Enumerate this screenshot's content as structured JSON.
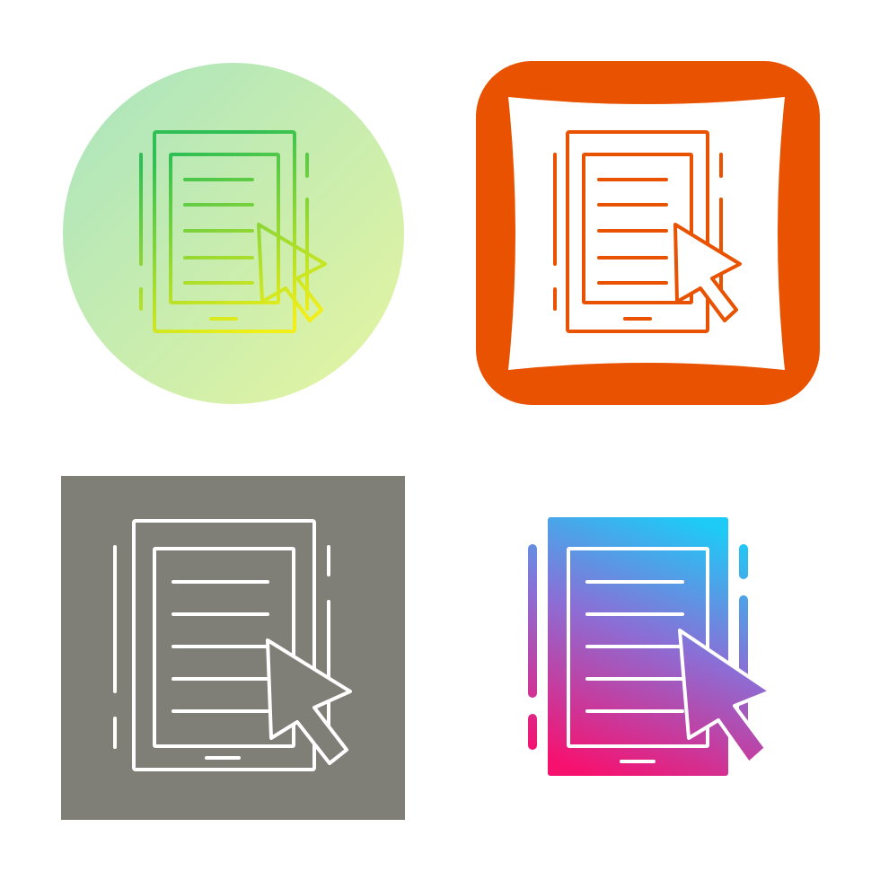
{
  "icon_set": {
    "subject": "tablet-document-cursor-icon",
    "variants": [
      {
        "style": "gradient-line-on-circle",
        "background_shape": "circle",
        "colors": {
          "background_from": "#a9e4bf",
          "background_to": "#e6f5a0",
          "stroke_from": "#2fbf54",
          "stroke_to": "#f1ef17"
        }
      },
      {
        "style": "line-on-cushion-square",
        "background_shape": "rounded-square",
        "colors": {
          "background": "#e85200",
          "cushion": "#ffffff",
          "stroke": "#e85200"
        }
      },
      {
        "style": "white-line-on-square",
        "background_shape": "square",
        "colors": {
          "background": "#7f7e77",
          "stroke": "#ffffff"
        }
      },
      {
        "style": "gradient-glyph",
        "background_shape": "none",
        "colors": {
          "gradient_top": "#1ecaf6",
          "gradient_mid": "#8a6fd6",
          "gradient_bottom": "#f7116f",
          "detail": "#ffffff"
        }
      }
    ]
  }
}
